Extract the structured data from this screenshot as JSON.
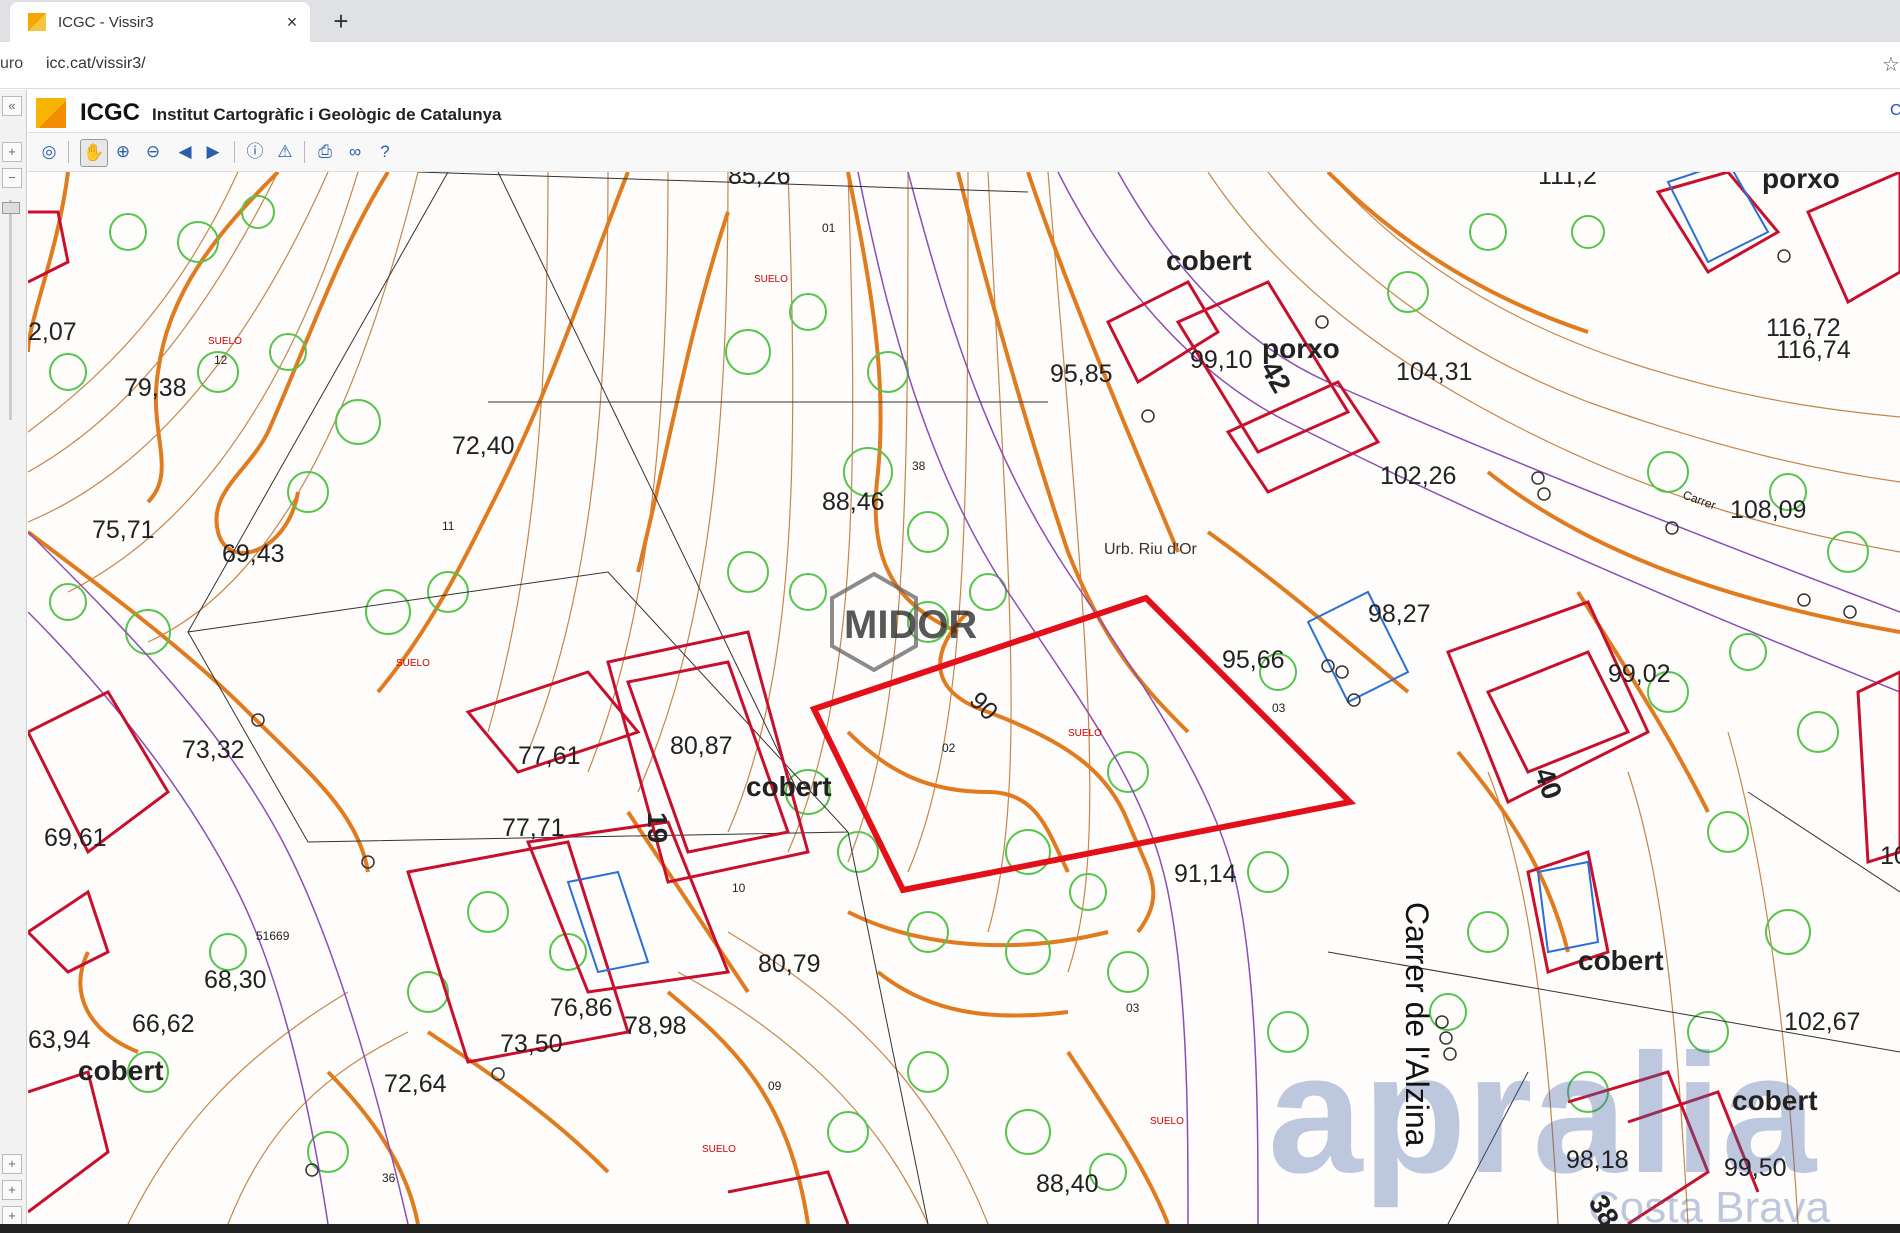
{
  "browser": {
    "tab_title": "ICGC - Vissir3",
    "close_glyph": "×",
    "new_tab_glyph": "+",
    "secure_label": "uro",
    "url": "icc.cat/vissir3/",
    "star_glyph": "☆"
  },
  "header": {
    "logo_text": "ICGC",
    "full_name": "Institut Cartogràfic i Geològic de Catalunya",
    "right_link": "C"
  },
  "toolbar": {
    "icons": [
      "globe-icon",
      "hand-icon",
      "zoom-in-icon",
      "zoom-out-icon",
      "back-icon",
      "forward-icon",
      "info-icon",
      "warning-icon",
      "print-icon",
      "link-icon",
      "help-icon"
    ]
  },
  "colors": {
    "contour": "#e07b1f",
    "contour_thin": "#c4864a",
    "building": "#c8102e",
    "vegetation": "#57c44d",
    "street_line": "#8a4fb5",
    "highlight": "#e3101a"
  },
  "map": {
    "elevations": [
      "85,26",
      "111,2",
      "79,38",
      "72,40",
      "88,46",
      "95,85",
      "104,31",
      "99,10",
      "116,72",
      "116,74",
      "102,26",
      "108,09",
      "75,71",
      "69,43",
      "98,27",
      "95,66",
      "99,02",
      "73,32",
      "77,61",
      "80,87",
      "77,71",
      "69,61",
      "91,14",
      "80,79",
      "68,30",
      "76,86",
      "66,62",
      "78,98",
      "63,94",
      "73,50",
      "72,64",
      "88,40",
      "102,67",
      "98,18",
      "99,50",
      "2,07",
      "10"
    ],
    "labels": {
      "cobert": "cobert",
      "porxo": "porxo",
      "street": "Carrer de l'Alzina",
      "urb": "Urb. Riu d'Or",
      "carrer_small": "Carrer",
      "contour_90": "90",
      "suelo": "SUELO",
      "watermark_midor": "MIDOR",
      "watermark_apralia": "apralia",
      "watermark_costa": "Costa Brava",
      "plot_02": "02",
      "plot_01": "01",
      "plot_03": "03",
      "plot_09": "09",
      "plot_11": "11",
      "plot_12": "12",
      "num_38": "38",
      "num_40": "40",
      "num_19": "19",
      "num_42": "42",
      "num_36": "36",
      "num_10": "10",
      "num_51669": "51669"
    }
  }
}
